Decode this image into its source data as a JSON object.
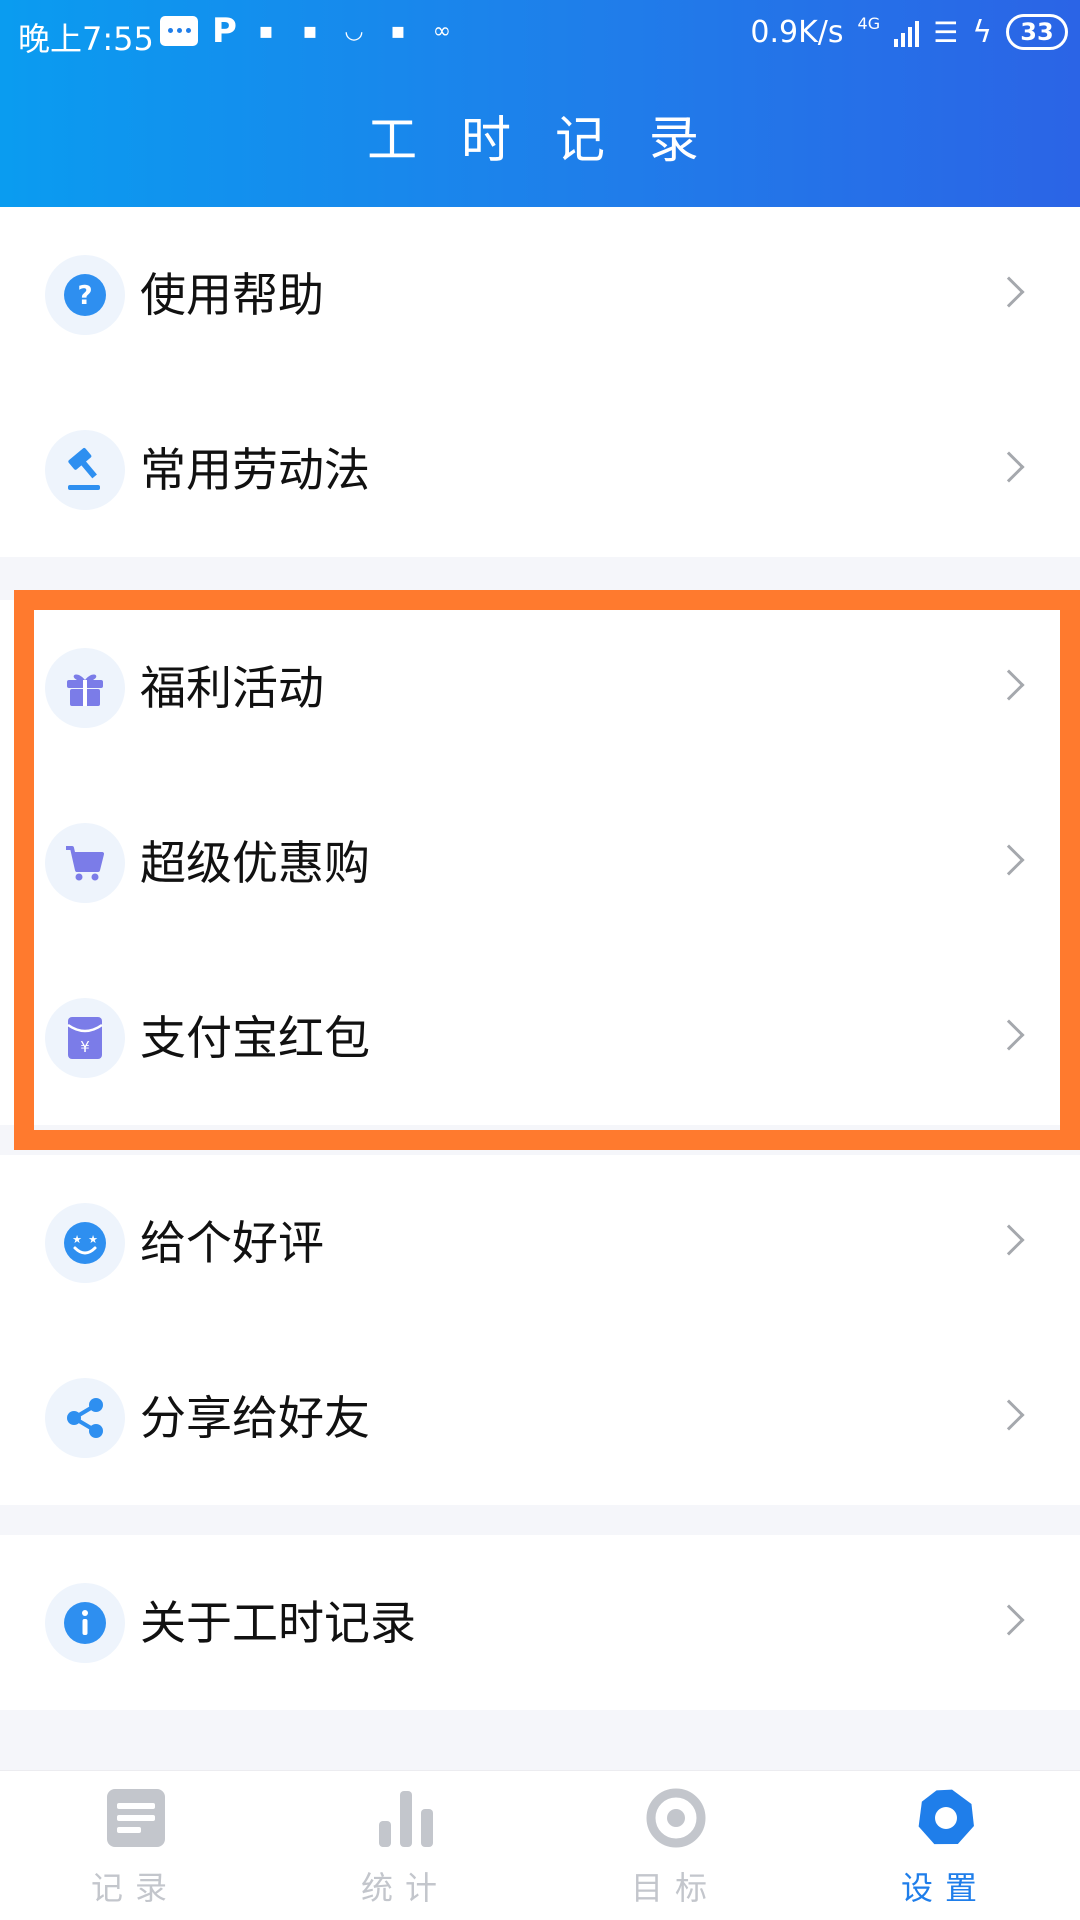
{
  "status_bar": {
    "time": "晚上7:55",
    "net_speed": "0.9K/s",
    "network": "4G",
    "battery": "33"
  },
  "header": {
    "title": "工 时 记 录"
  },
  "menu_groups": [
    {
      "items": [
        {
          "label": "使用帮助",
          "icon": "help-circle-icon"
        },
        {
          "label": "常用劳动法",
          "icon": "gavel-icon"
        }
      ]
    },
    {
      "items": [
        {
          "label": "福利活动",
          "icon": "gift-icon"
        },
        {
          "label": "超级优惠购",
          "icon": "shopping-cart-icon"
        },
        {
          "label": "支付宝红包",
          "icon": "red-packet-icon"
        }
      ]
    },
    {
      "items": [
        {
          "label": "给个好评",
          "icon": "smile-star-icon"
        },
        {
          "label": "分享给好友",
          "icon": "share-icon"
        }
      ]
    },
    {
      "items": [
        {
          "label": "关于工时记录",
          "icon": "info-icon"
        }
      ]
    }
  ],
  "tab_bar": [
    {
      "label": "记录",
      "icon": "document-icon",
      "active": false
    },
    {
      "label": "统计",
      "icon": "bar-chart-icon",
      "active": false
    },
    {
      "label": "目标",
      "icon": "target-icon",
      "active": false
    },
    {
      "label": "设置",
      "icon": "settings-icon",
      "active": true
    }
  ],
  "colors": {
    "header_start": "#0a9cf0",
    "header_end": "#2b64e6",
    "accent": "#1f7eea",
    "icon_purple": "#7b7ce8",
    "highlight_border": "#ff7a2e"
  }
}
